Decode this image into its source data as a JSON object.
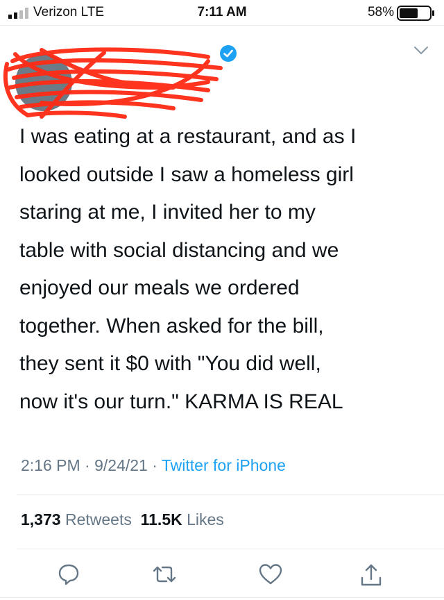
{
  "status_bar": {
    "carrier": "Verizon  LTE",
    "time": "7:11 AM",
    "battery_percent": "58%"
  },
  "tweet": {
    "text": "I was eating at a restaurant, and as I\nlooked outside I saw a homeless girl\nstaring at me, I invited her to my\ntable with social distancing and we\nenjoyed our meals we ordered\ntogether. When asked for the bill,\nthey sent it $0 with \"You did well,\nnow it's our turn.\" KARMA IS REAL",
    "time": "2:16 PM",
    "separator": " · ",
    "date": "9/24/21",
    "source": "Twitter for iPhone"
  },
  "stats": {
    "retweets_count": "1,373",
    "retweets_label": "Retweets",
    "likes_count": "11.5K",
    "likes_label": "Likes"
  },
  "actions": [
    "reply-icon",
    "retweet-icon",
    "like-icon",
    "share-icon"
  ],
  "colors": {
    "accent": "#1da1f2",
    "muted": "#657786",
    "text": "#0f1419",
    "redaction": "#ff2a14"
  }
}
